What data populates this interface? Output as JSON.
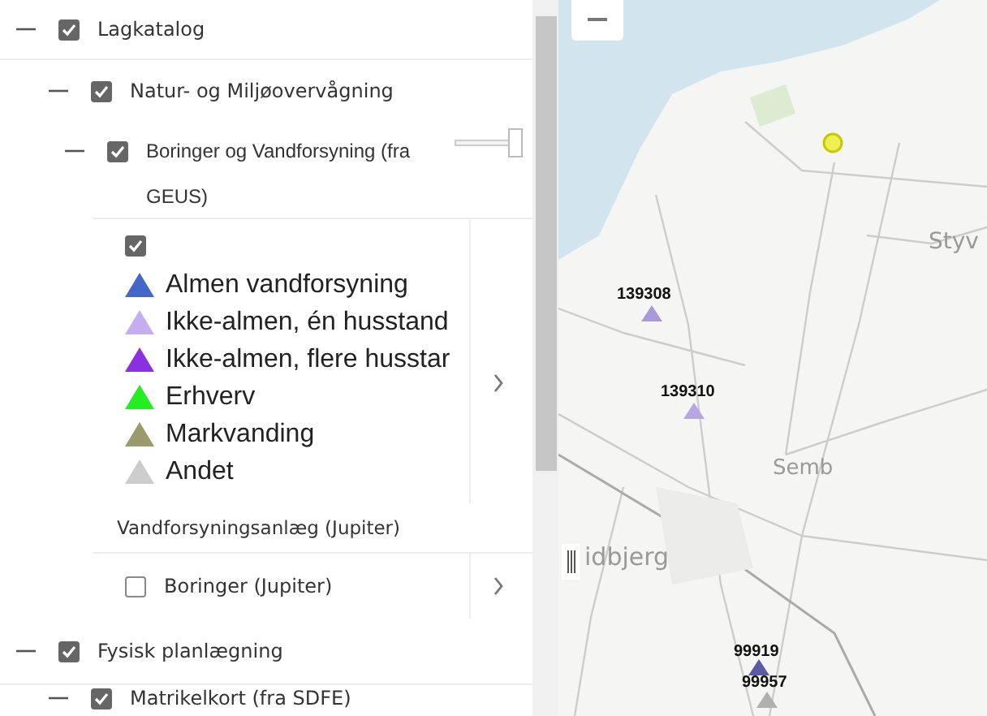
{
  "tree": [
    {
      "label": "Lagkatalog",
      "checked": true,
      "expanded": true,
      "children": [
        {
          "label": "Natur- og Miljøovervågning",
          "checked": true,
          "expanded": true,
          "children": [
            {
              "kind": "layer",
              "label": "Boringer og Vandforsyning (fra GEUS)",
              "checked": true,
              "expanded": true,
              "opacity": {
                "level": 1
              },
              "legend": {
                "checked": true,
                "items": [
                  {
                    "label": "Almen vandforsyning",
                    "color": "#4468c8"
                  },
                  {
                    "label": "Ikke-almen, én husstand",
                    "color": "#c4aef0"
                  },
                  {
                    "label": "Ikke-almen, flere husstar",
                    "color": "#8a30e0"
                  },
                  {
                    "label": "Erhverv",
                    "color": "#22ee22"
                  },
                  {
                    "label": "Markvanding",
                    "color": "#9a9a6a"
                  },
                  {
                    "label": "Andet",
                    "color": "#cccccc"
                  }
                ]
              }
            },
            {
              "kind": "heading",
              "label": "Vandforsyningsanlæg (Jupiter)"
            },
            {
              "kind": "layer",
              "label": "Boringer (Jupiter)",
              "checked": false
            }
          ]
        }
      ]
    },
    {
      "label": "Fysisk planlægning",
      "checked": true,
      "expanded": true,
      "children": [
        {
          "kind": "layer",
          "label": "Matrikelkort (fra SDFE)",
          "checked": true,
          "expanded": true
        }
      ]
    }
  ],
  "map": {
    "place_labels": [
      "Styv",
      "Semb",
      "idbjerg"
    ],
    "wells": [
      {
        "label": "139308",
        "color": "#a89ad8"
      },
      {
        "label": "139310",
        "color": "#b6a6e2"
      },
      {
        "label": "99919",
        "color": "#5a5aa8"
      },
      {
        "label": "99957",
        "color": "#b0b0b0"
      }
    ]
  }
}
